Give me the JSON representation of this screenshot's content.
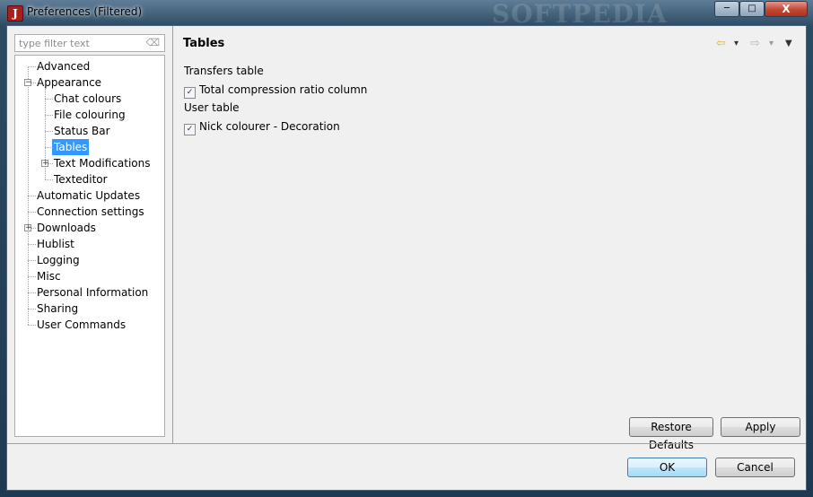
{
  "window": {
    "title": "Preferences (Filtered)",
    "app_icon_glyph": "J",
    "watermark": "SOFTPEDIA",
    "controls": {
      "minimize": "─",
      "maximize": "□",
      "close": "X"
    }
  },
  "filter": {
    "placeholder": "type filter text",
    "clear_icon": "⌫"
  },
  "tree": [
    {
      "label": "Advanced",
      "level": 0,
      "expander": null
    },
    {
      "label": "Appearance",
      "level": 0,
      "expander": "−"
    },
    {
      "label": "Chat colours",
      "level": 1,
      "expander": null
    },
    {
      "label": "File colouring",
      "level": 1,
      "expander": null
    },
    {
      "label": "Status Bar",
      "level": 1,
      "expander": null
    },
    {
      "label": "Tables",
      "level": 1,
      "expander": null,
      "selected": true
    },
    {
      "label": "Text Modifications",
      "level": 1,
      "expander": "+"
    },
    {
      "label": "Texteditor",
      "level": 1,
      "expander": null
    },
    {
      "label": "Automatic Updates",
      "level": 0,
      "expander": null
    },
    {
      "label": "Connection settings",
      "level": 0,
      "expander": null
    },
    {
      "label": "Downloads",
      "level": 0,
      "expander": "+"
    },
    {
      "label": "Hublist",
      "level": 0,
      "expander": null
    },
    {
      "label": "Logging",
      "level": 0,
      "expander": null
    },
    {
      "label": "Misc",
      "level": 0,
      "expander": null
    },
    {
      "label": "Personal Information",
      "level": 0,
      "expander": null
    },
    {
      "label": "Sharing",
      "level": 0,
      "expander": null
    },
    {
      "label": "User Commands",
      "level": 0,
      "expander": null
    }
  ],
  "page": {
    "title": "Tables",
    "nav": {
      "back": "⇦",
      "back_menu": "▾",
      "forward": "⇨",
      "forward_menu": "▾",
      "view_menu": "▼"
    },
    "groups": [
      {
        "label": "Transfers table",
        "options": [
          {
            "label": "Total compression ratio column",
            "checked": true
          }
        ]
      },
      {
        "label": "User table",
        "options": [
          {
            "label": "Nick colourer - Decoration",
            "checked": true
          }
        ]
      }
    ],
    "restore_defaults": "Restore Defaults",
    "apply": "Apply"
  },
  "dialog": {
    "ok": "OK",
    "cancel": "Cancel"
  },
  "colors": {
    "selection": "#3399ff",
    "panel": "#f0f0f0",
    "back_arrow": "#e8b21e",
    "forward_arrow": "#b8b8b8"
  }
}
